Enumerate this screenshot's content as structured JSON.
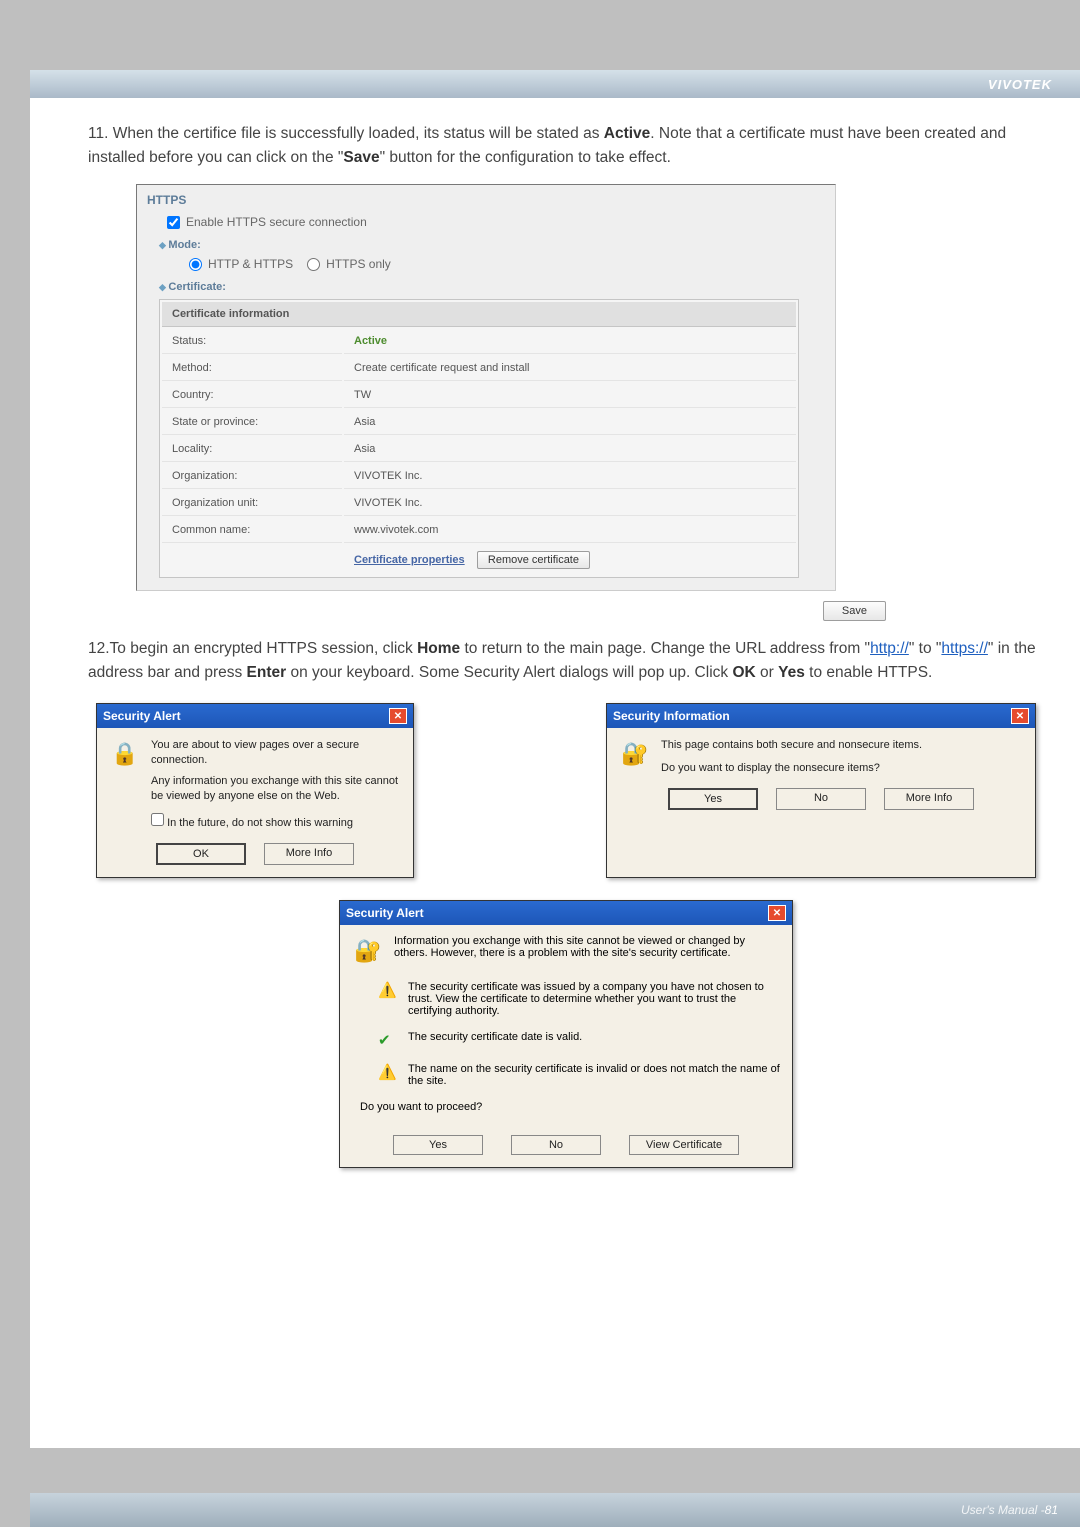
{
  "brand": "VIVOTEK",
  "step11": {
    "prefix": "11. When the certifice file is successfully loaded, its status will be stated as ",
    "active": "Active",
    "mid": ". Note that a certificate must have been created and installed before you can click on the \"",
    "save": "Save",
    "suffix": "\" button for the configuration to take effect."
  },
  "https_panel": {
    "legend": "HTTPS",
    "enable_label": "Enable HTTPS secure connection",
    "mode_label": "Mode:",
    "mode_opt1": "HTTP & HTTPS",
    "mode_opt2": "HTTPS only",
    "cert_label": "Certificate:",
    "cert_header": "Certificate information",
    "rows": {
      "status_label": "Status:",
      "status_value": "Active",
      "method_label": "Method:",
      "method_value": "Create certificate request and install",
      "country_label": "Country:",
      "country_value": "TW",
      "state_label": "State or province:",
      "state_value": "Asia",
      "locality_label": "Locality:",
      "locality_value": "Asia",
      "org_label": "Organization:",
      "org_value": "VIVOTEK Inc.",
      "ou_label": "Organization unit:",
      "ou_value": "VIVOTEK Inc.",
      "cn_label": "Common name:",
      "cn_value": "www.vivotek.com"
    },
    "cert_props": "Certificate properties",
    "remove_cert": "Remove certificate",
    "save_btn": "Save"
  },
  "step12": {
    "prefix": "12.To begin an encrypted HTTPS session, click ",
    "home": "Home",
    "mid1": " to return to the main page. Change the URL address from \"",
    "link1": "http://",
    "mid2": "\" to \"",
    "link2": "https://",
    "mid3": "\" in the address bar and press ",
    "enter": "Enter",
    "mid4": " on your keyboard. Some Security Alert dialogs will pop up. Click ",
    "ok": "OK",
    "or": " or ",
    "yes": "Yes",
    "suffix": " to enable HTTPS."
  },
  "dlg1": {
    "title": "Security Alert",
    "line1": "You are about to view pages over a secure connection.",
    "line2": "Any information you exchange with this site cannot be viewed by anyone else on the Web.",
    "chk": "In the future, do not show this warning",
    "ok": "OK",
    "more": "More Info"
  },
  "dlg2": {
    "title": "Security Information",
    "line1": "This page contains both secure and nonsecure items.",
    "line2": "Do you want to display the nonsecure items?",
    "yes": "Yes",
    "no": "No",
    "more": "More Info"
  },
  "dlg3": {
    "title": "Security Alert",
    "intro": "Information you exchange with this site cannot be viewed or changed by others. However, there is a problem with the site's security certificate.",
    "p1": "The security certificate was issued by a company you have not chosen to trust. View the certificate to determine whether you want to trust the certifying authority.",
    "p2": "The security certificate date is valid.",
    "p3": "The name on the security certificate is invalid or does not match the name of the site.",
    "q": "Do you want to proceed?",
    "yes": "Yes",
    "no": "No",
    "view": "View Certificate"
  },
  "footer": {
    "um": "User's Manual - ",
    "pg": "81"
  }
}
